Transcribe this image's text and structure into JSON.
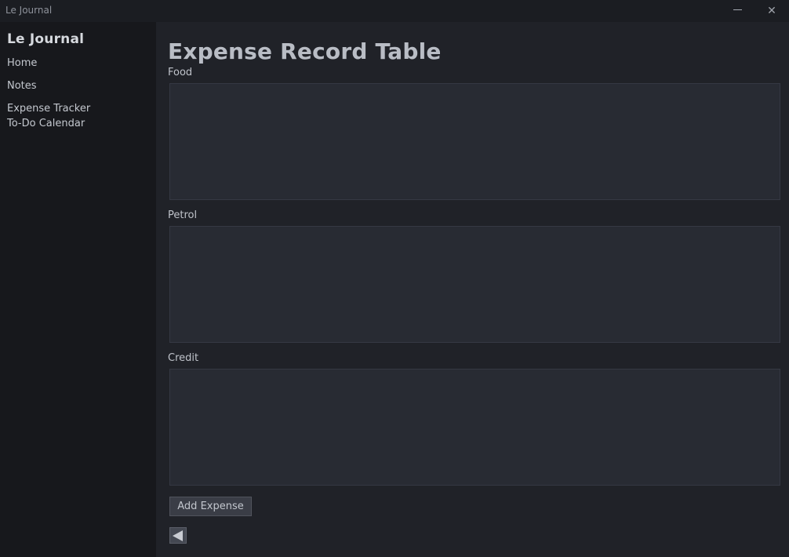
{
  "window": {
    "title": "Le Journal",
    "minimize_icon": "minimize-icon",
    "close_icon": "close-icon",
    "close_glyph": "✕"
  },
  "sidebar": {
    "brand": "Le Journal",
    "items": [
      {
        "label": "Home"
      },
      {
        "label": "Notes"
      },
      {
        "label": "Expense Tracker"
      },
      {
        "label": "To-Do Calendar"
      }
    ]
  },
  "main": {
    "title": "Expense Record Table",
    "fields": [
      {
        "label": "Food",
        "value": ""
      },
      {
        "label": "Petrol",
        "value": ""
      },
      {
        "label": "Credit",
        "value": ""
      }
    ],
    "add_button": "Add Expense",
    "back_icon": "back-arrow-icon"
  },
  "colors": {
    "background": "#202228",
    "sidebar": "#17181c",
    "text_area": "#282b33",
    "button": "#3a3d46"
  }
}
